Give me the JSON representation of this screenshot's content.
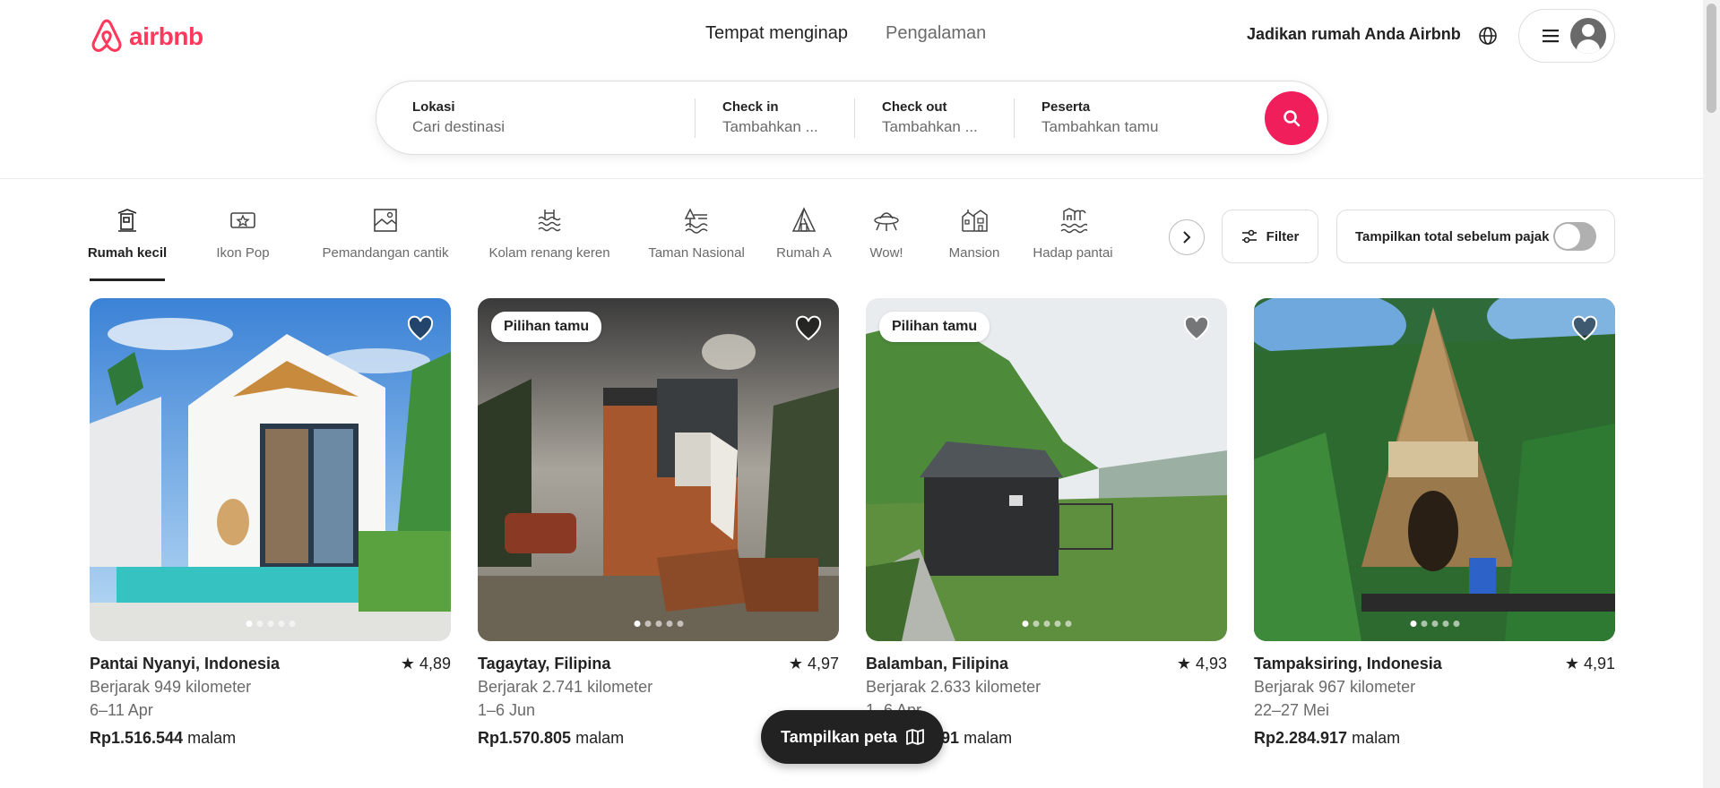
{
  "brand": {
    "name": "airbnb",
    "color": "#ff385c"
  },
  "top_tabs": [
    {
      "label": "Tempat menginap",
      "active": true
    },
    {
      "label": "Pengalaman",
      "active": false
    }
  ],
  "header": {
    "host_link": "Jadikan rumah Anda Airbnb",
    "globe_icon": "globe-icon",
    "menu_icon": "hamburger-icon"
  },
  "search": {
    "location": {
      "label": "Lokasi",
      "placeholder": "Cari destinasi"
    },
    "check_in": {
      "label": "Check in",
      "placeholder": "Tambahkan ..."
    },
    "check_out": {
      "label": "Check out",
      "placeholder": "Tambahkan ..."
    },
    "guests": {
      "label": "Peserta",
      "placeholder": "Tambahkan tamu"
    },
    "button_icon": "search-icon"
  },
  "categories": [
    {
      "label": "Rumah kecil",
      "icon": "tiny-home-icon",
      "active": true
    },
    {
      "label": "Ikon Pop",
      "icon": "pop-icon",
      "active": false
    },
    {
      "label": "Pemandangan cantik",
      "icon": "view-icon",
      "active": false
    },
    {
      "label": "Kolam renang keren",
      "icon": "pool-icon",
      "active": false
    },
    {
      "label": "Taman Nasional",
      "icon": "national-park-icon",
      "active": false
    },
    {
      "label": "Rumah A",
      "icon": "a-frame-icon",
      "active": false
    },
    {
      "label": "Wow!",
      "icon": "ufo-icon",
      "active": false
    },
    {
      "label": "Mansion",
      "icon": "mansion-icon",
      "active": false
    },
    {
      "label": "Hadap pantai",
      "icon": "beachfront-icon",
      "active": false
    }
  ],
  "filters": {
    "label": "Filter",
    "tax_toggle_label": "Tampilkan total sebelum pajak",
    "tax_toggle_on": false
  },
  "listings": [
    {
      "title": "Pantai Nyanyi, Indonesia",
      "rating": "4,89",
      "distance": "Berjarak 949 kilometer",
      "dates": "6–11 Apr",
      "price": "Rp1.516.544",
      "unit": "malam",
      "badge": ""
    },
    {
      "title": "Tagaytay, Filipina",
      "rating": "4,97",
      "distance": "Berjarak 2.741 kilometer",
      "dates": "1–6 Jun",
      "price": "Rp1.570.805",
      "unit": "malam",
      "badge": "Pilihan tamu"
    },
    {
      "title": "Balamban, Filipina",
      "rating": "4,93",
      "distance": "Berjarak 2.633 kilometer",
      "dates": "1–6 Apr",
      "price": "Rp1.570.891",
      "unit": "malam",
      "badge": "Pilihan tamu"
    },
    {
      "title": "Tampaksiring, Indonesia",
      "rating": "4,91",
      "distance": "Berjarak 967 kilometer",
      "dates": "22–27 Mei",
      "price": "Rp2.284.917",
      "unit": "malam",
      "badge": ""
    }
  ],
  "map_button": {
    "label": "Tampilkan peta",
    "icon": "map-icon"
  }
}
